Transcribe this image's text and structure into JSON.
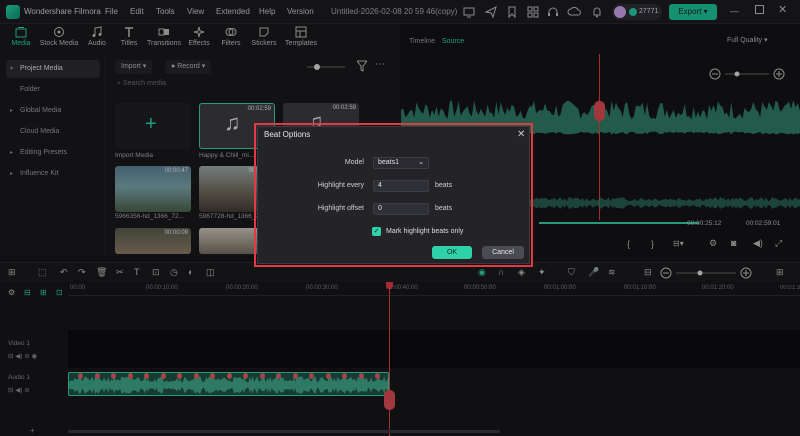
{
  "titlebar": {
    "app_name": "Wondershare Filmora",
    "menu": [
      "File",
      "Edit",
      "Tools",
      "View",
      "Extended",
      "Help",
      "Version"
    ],
    "doc_title": "Untitled-2026-02-08 20 59 46(copy)",
    "credits": "27771",
    "export_label": "Export"
  },
  "media_tabs": [
    {
      "label": "Media",
      "icon": "media-icon"
    },
    {
      "label": "Stock Media",
      "icon": "stock-media-icon"
    },
    {
      "label": "Audio",
      "icon": "audio-icon"
    },
    {
      "label": "Titles",
      "icon": "titles-icon"
    },
    {
      "label": "Transitions",
      "icon": "transitions-icon"
    },
    {
      "label": "Effects",
      "icon": "effects-icon"
    },
    {
      "label": "Filters",
      "icon": "filters-icon"
    },
    {
      "label": "Stickers",
      "icon": "stickers-icon"
    },
    {
      "label": "Templates",
      "icon": "templates-icon"
    }
  ],
  "sidebar": {
    "items": [
      {
        "label": "Project Media"
      },
      {
        "label": "Folder"
      },
      {
        "label": "Global Media"
      },
      {
        "label": "Cloud Media"
      },
      {
        "label": "Editing Presets"
      },
      {
        "label": "Influence Kit"
      }
    ]
  },
  "media": {
    "import_label": "Import",
    "record_label": "Record",
    "search_placeholder": "Search media",
    "import_media_label": "Import Media",
    "items": [
      {
        "label": "Happy & Chill_mi...",
        "duration": "00:02:59"
      },
      {
        "label": "",
        "duration": "00:02:59"
      },
      {
        "label": "5966356-hd_1366_72...",
        "duration": "00:00:47"
      },
      {
        "label": "5967728-hd_1366_72...",
        "duration": "00:00:15"
      },
      {
        "label": "",
        "duration": "00:00:09"
      },
      {
        "label": "",
        "duration": ""
      }
    ]
  },
  "preview": {
    "timeline_tab": "Timeline",
    "source_tab": "Source",
    "quality": "Full Quality",
    "current_time": "00:00:25:12",
    "total_time": "00:02:59:01"
  },
  "ruler": [
    "00:00",
    "00:00:10:00",
    "00:00:20:00",
    "00:00:30:00",
    "00:00:40:00",
    "00:00:50:00",
    "00:01:00:00",
    "00:01:10:00",
    "00:01:20:00",
    "00:01:30:00"
  ],
  "tracks": {
    "video": "Video 1",
    "audio": "Audio 1"
  },
  "dialog": {
    "title": "Beat Options",
    "model_label": "Model",
    "model_value": "beats1",
    "highlight_every_label": "Highlight every",
    "highlight_every_value": "4",
    "highlight_offset_label": "Highlight offset",
    "highlight_offset_value": "0",
    "unit": "beats",
    "mark_label": "Mark highlight beats only",
    "mark_checked": true,
    "ok_label": "OK",
    "cancel_label": "Cancel"
  },
  "colors": {
    "accent": "#2fd1a8",
    "highlight": "#e23a45",
    "waveform": "#2f7a63"
  }
}
